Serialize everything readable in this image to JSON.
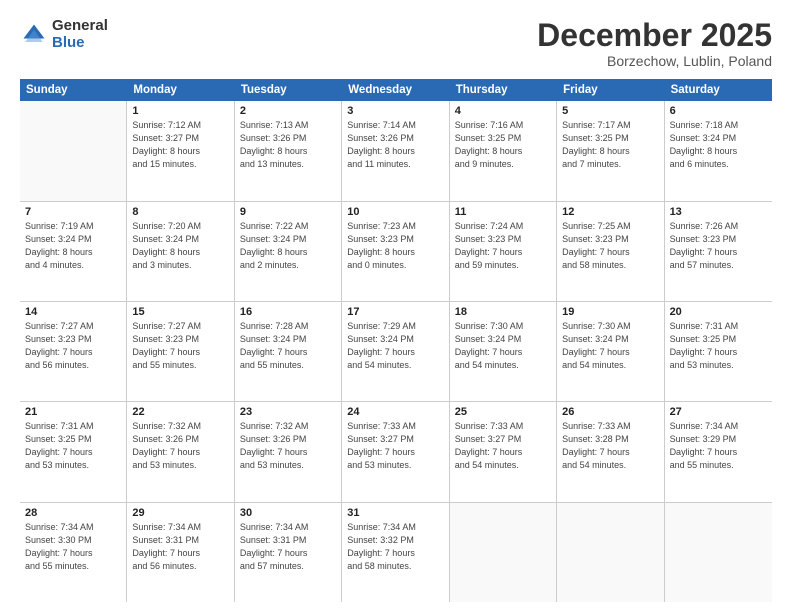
{
  "logo": {
    "general": "General",
    "blue": "Blue"
  },
  "header": {
    "month": "December 2025",
    "location": "Borzechow, Lublin, Poland"
  },
  "weekdays": [
    "Sunday",
    "Monday",
    "Tuesday",
    "Wednesday",
    "Thursday",
    "Friday",
    "Saturday"
  ],
  "weeks": [
    [
      {
        "day": "",
        "sunrise": "",
        "sunset": "",
        "daylight": "",
        "empty": true
      },
      {
        "day": "1",
        "sunrise": "Sunrise: 7:12 AM",
        "sunset": "Sunset: 3:27 PM",
        "daylight": "Daylight: 8 hours",
        "daylight2": "and 15 minutes."
      },
      {
        "day": "2",
        "sunrise": "Sunrise: 7:13 AM",
        "sunset": "Sunset: 3:26 PM",
        "daylight": "Daylight: 8 hours",
        "daylight2": "and 13 minutes."
      },
      {
        "day": "3",
        "sunrise": "Sunrise: 7:14 AM",
        "sunset": "Sunset: 3:26 PM",
        "daylight": "Daylight: 8 hours",
        "daylight2": "and 11 minutes."
      },
      {
        "day": "4",
        "sunrise": "Sunrise: 7:16 AM",
        "sunset": "Sunset: 3:25 PM",
        "daylight": "Daylight: 8 hours",
        "daylight2": "and 9 minutes."
      },
      {
        "day": "5",
        "sunrise": "Sunrise: 7:17 AM",
        "sunset": "Sunset: 3:25 PM",
        "daylight": "Daylight: 8 hours",
        "daylight2": "and 7 minutes."
      },
      {
        "day": "6",
        "sunrise": "Sunrise: 7:18 AM",
        "sunset": "Sunset: 3:24 PM",
        "daylight": "Daylight: 8 hours",
        "daylight2": "and 6 minutes."
      }
    ],
    [
      {
        "day": "7",
        "sunrise": "Sunrise: 7:19 AM",
        "sunset": "Sunset: 3:24 PM",
        "daylight": "Daylight: 8 hours",
        "daylight2": "and 4 minutes."
      },
      {
        "day": "8",
        "sunrise": "Sunrise: 7:20 AM",
        "sunset": "Sunset: 3:24 PM",
        "daylight": "Daylight: 8 hours",
        "daylight2": "and 3 minutes."
      },
      {
        "day": "9",
        "sunrise": "Sunrise: 7:22 AM",
        "sunset": "Sunset: 3:24 PM",
        "daylight": "Daylight: 8 hours",
        "daylight2": "and 2 minutes."
      },
      {
        "day": "10",
        "sunrise": "Sunrise: 7:23 AM",
        "sunset": "Sunset: 3:23 PM",
        "daylight": "Daylight: 8 hours",
        "daylight2": "and 0 minutes."
      },
      {
        "day": "11",
        "sunrise": "Sunrise: 7:24 AM",
        "sunset": "Sunset: 3:23 PM",
        "daylight": "Daylight: 7 hours",
        "daylight2": "and 59 minutes."
      },
      {
        "day": "12",
        "sunrise": "Sunrise: 7:25 AM",
        "sunset": "Sunset: 3:23 PM",
        "daylight": "Daylight: 7 hours",
        "daylight2": "and 58 minutes."
      },
      {
        "day": "13",
        "sunrise": "Sunrise: 7:26 AM",
        "sunset": "Sunset: 3:23 PM",
        "daylight": "Daylight: 7 hours",
        "daylight2": "and 57 minutes."
      }
    ],
    [
      {
        "day": "14",
        "sunrise": "Sunrise: 7:27 AM",
        "sunset": "Sunset: 3:23 PM",
        "daylight": "Daylight: 7 hours",
        "daylight2": "and 56 minutes."
      },
      {
        "day": "15",
        "sunrise": "Sunrise: 7:27 AM",
        "sunset": "Sunset: 3:23 PM",
        "daylight": "Daylight: 7 hours",
        "daylight2": "and 55 minutes."
      },
      {
        "day": "16",
        "sunrise": "Sunrise: 7:28 AM",
        "sunset": "Sunset: 3:24 PM",
        "daylight": "Daylight: 7 hours",
        "daylight2": "and 55 minutes."
      },
      {
        "day": "17",
        "sunrise": "Sunrise: 7:29 AM",
        "sunset": "Sunset: 3:24 PM",
        "daylight": "Daylight: 7 hours",
        "daylight2": "and 54 minutes."
      },
      {
        "day": "18",
        "sunrise": "Sunrise: 7:30 AM",
        "sunset": "Sunset: 3:24 PM",
        "daylight": "Daylight: 7 hours",
        "daylight2": "and 54 minutes."
      },
      {
        "day": "19",
        "sunrise": "Sunrise: 7:30 AM",
        "sunset": "Sunset: 3:24 PM",
        "daylight": "Daylight: 7 hours",
        "daylight2": "and 54 minutes."
      },
      {
        "day": "20",
        "sunrise": "Sunrise: 7:31 AM",
        "sunset": "Sunset: 3:25 PM",
        "daylight": "Daylight: 7 hours",
        "daylight2": "and 53 minutes."
      }
    ],
    [
      {
        "day": "21",
        "sunrise": "Sunrise: 7:31 AM",
        "sunset": "Sunset: 3:25 PM",
        "daylight": "Daylight: 7 hours",
        "daylight2": "and 53 minutes."
      },
      {
        "day": "22",
        "sunrise": "Sunrise: 7:32 AM",
        "sunset": "Sunset: 3:26 PM",
        "daylight": "Daylight: 7 hours",
        "daylight2": "and 53 minutes."
      },
      {
        "day": "23",
        "sunrise": "Sunrise: 7:32 AM",
        "sunset": "Sunset: 3:26 PM",
        "daylight": "Daylight: 7 hours",
        "daylight2": "and 53 minutes."
      },
      {
        "day": "24",
        "sunrise": "Sunrise: 7:33 AM",
        "sunset": "Sunset: 3:27 PM",
        "daylight": "Daylight: 7 hours",
        "daylight2": "and 53 minutes."
      },
      {
        "day": "25",
        "sunrise": "Sunrise: 7:33 AM",
        "sunset": "Sunset: 3:27 PM",
        "daylight": "Daylight: 7 hours",
        "daylight2": "and 54 minutes."
      },
      {
        "day": "26",
        "sunrise": "Sunrise: 7:33 AM",
        "sunset": "Sunset: 3:28 PM",
        "daylight": "Daylight: 7 hours",
        "daylight2": "and 54 minutes."
      },
      {
        "day": "27",
        "sunrise": "Sunrise: 7:34 AM",
        "sunset": "Sunset: 3:29 PM",
        "daylight": "Daylight: 7 hours",
        "daylight2": "and 55 minutes."
      }
    ],
    [
      {
        "day": "28",
        "sunrise": "Sunrise: 7:34 AM",
        "sunset": "Sunset: 3:30 PM",
        "daylight": "Daylight: 7 hours",
        "daylight2": "and 55 minutes."
      },
      {
        "day": "29",
        "sunrise": "Sunrise: 7:34 AM",
        "sunset": "Sunset: 3:31 PM",
        "daylight": "Daylight: 7 hours",
        "daylight2": "and 56 minutes."
      },
      {
        "day": "30",
        "sunrise": "Sunrise: 7:34 AM",
        "sunset": "Sunset: 3:31 PM",
        "daylight": "Daylight: 7 hours",
        "daylight2": "and 57 minutes."
      },
      {
        "day": "31",
        "sunrise": "Sunrise: 7:34 AM",
        "sunset": "Sunset: 3:32 PM",
        "daylight": "Daylight: 7 hours",
        "daylight2": "and 58 minutes."
      },
      {
        "day": "",
        "sunrise": "",
        "sunset": "",
        "daylight": "",
        "daylight2": "",
        "empty": true
      },
      {
        "day": "",
        "sunrise": "",
        "sunset": "",
        "daylight": "",
        "daylight2": "",
        "empty": true
      },
      {
        "day": "",
        "sunrise": "",
        "sunset": "",
        "daylight": "",
        "daylight2": "",
        "empty": true
      }
    ]
  ]
}
